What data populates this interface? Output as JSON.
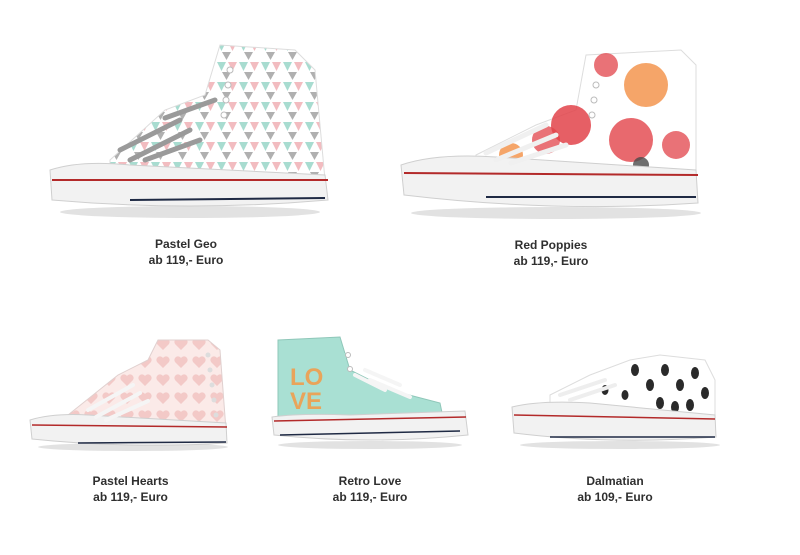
{
  "products": [
    {
      "name": "Pastel Geo",
      "price": "ab 119,- Euro",
      "design": "pastel-triangles",
      "style": "high-top"
    },
    {
      "name": "Red Poppies",
      "price": "ab 119,- Euro",
      "design": "red-poppies",
      "style": "high-top"
    },
    {
      "name": "Pastel Hearts",
      "price": "ab 119,- Euro",
      "design": "pastel-hearts",
      "style": "high-top"
    },
    {
      "name": "Retro Love",
      "price": "ab 119,- Euro",
      "design": "retro-love",
      "style": "high-top"
    },
    {
      "name": "Dalmatian",
      "price": "ab 109,- Euro",
      "design": "dalmatian-spots",
      "style": "low-top"
    }
  ],
  "colors": {
    "sole": "#f2f2f2",
    "stripe_red": "#b32a2a",
    "stripe_navy": "#1f2a44",
    "geo_mint": "#a8dcd0",
    "geo_pink": "#f2bcc0",
    "geo_grey": "#9c9c9c",
    "poppy_red": "#e2434a",
    "poppy_orange": "#f3954f",
    "hearts_pink": "#f3c9c7",
    "retro_mint": "#a9e0d3",
    "retro_letters": "#e9a45a",
    "dalmatian_spot": "#2a2a2a"
  },
  "retro_word": "LOVE"
}
